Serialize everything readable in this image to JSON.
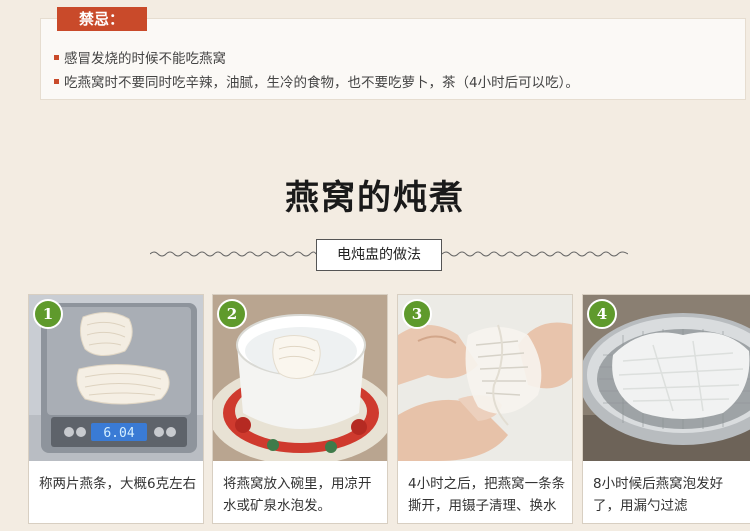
{
  "warning": {
    "tag": "禁忌：",
    "items": [
      "感冒发烧的时候不能吃燕窝",
      "吃燕窝时不要同时吃辛辣，油腻，生冷的食物，也不要吃萝卜，茶（4小时后可以吃）。"
    ]
  },
  "section": {
    "title": "燕窝的炖煮",
    "subtitle": "电炖盅的做法"
  },
  "steps": [
    {
      "num": "1",
      "desc": "称两片燕条，大概6克左右",
      "scale_display": "6.04"
    },
    {
      "num": "2",
      "desc": "将燕窝放入碗里，用凉开水或矿泉水泡发。"
    },
    {
      "num": "3",
      "desc": "4小时之后，把燕窝一条条撕开，用镊子清理、换水"
    },
    {
      "num": "4",
      "desc": "8小时候后燕窝泡发好了，用漏勺过滤"
    }
  ],
  "colors": {
    "accent": "#c94a2a",
    "badge": "#5f9a2c",
    "background": "#f3ece2"
  }
}
